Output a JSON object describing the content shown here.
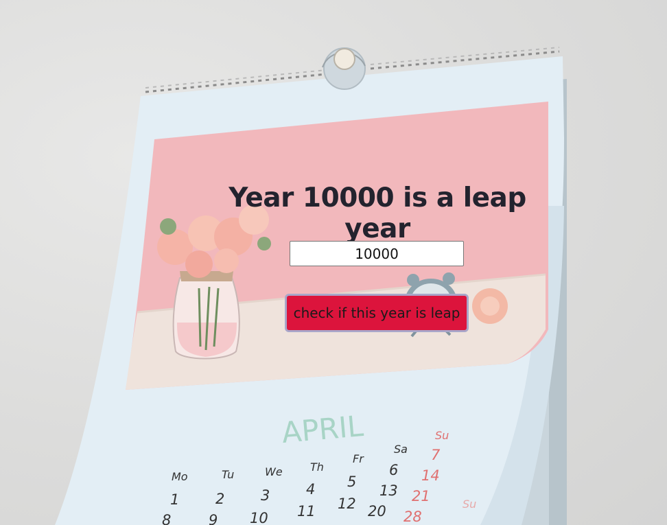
{
  "result": {
    "text": "Year 10000 is a leap year"
  },
  "form": {
    "year_value": "10000",
    "button_label": "check if this year is leap"
  },
  "calendar": {
    "month": "APRIL",
    "weekdays": [
      "Mo",
      "Tu",
      "We",
      "Th",
      "Fr",
      "Sa",
      "Su"
    ],
    "row1": [
      "1",
      "2",
      "3",
      "4",
      "5",
      "6",
      "7"
    ],
    "row2": [
      "8",
      "9",
      "10",
      "11",
      "12",
      "13",
      "14"
    ],
    "row3": [
      "",
      "",
      "",
      "",
      "",
      "20",
      "21"
    ],
    "row4": [
      "",
      "",
      "",
      "",
      "",
      "",
      "28"
    ],
    "next_page_su": "Su"
  },
  "colors": {
    "accent": "#dc143c",
    "heading": "#23232e",
    "photo_pink": "#f3b9bd",
    "month_teal": "#a8d4c6",
    "sunday_red": "#e07070"
  }
}
